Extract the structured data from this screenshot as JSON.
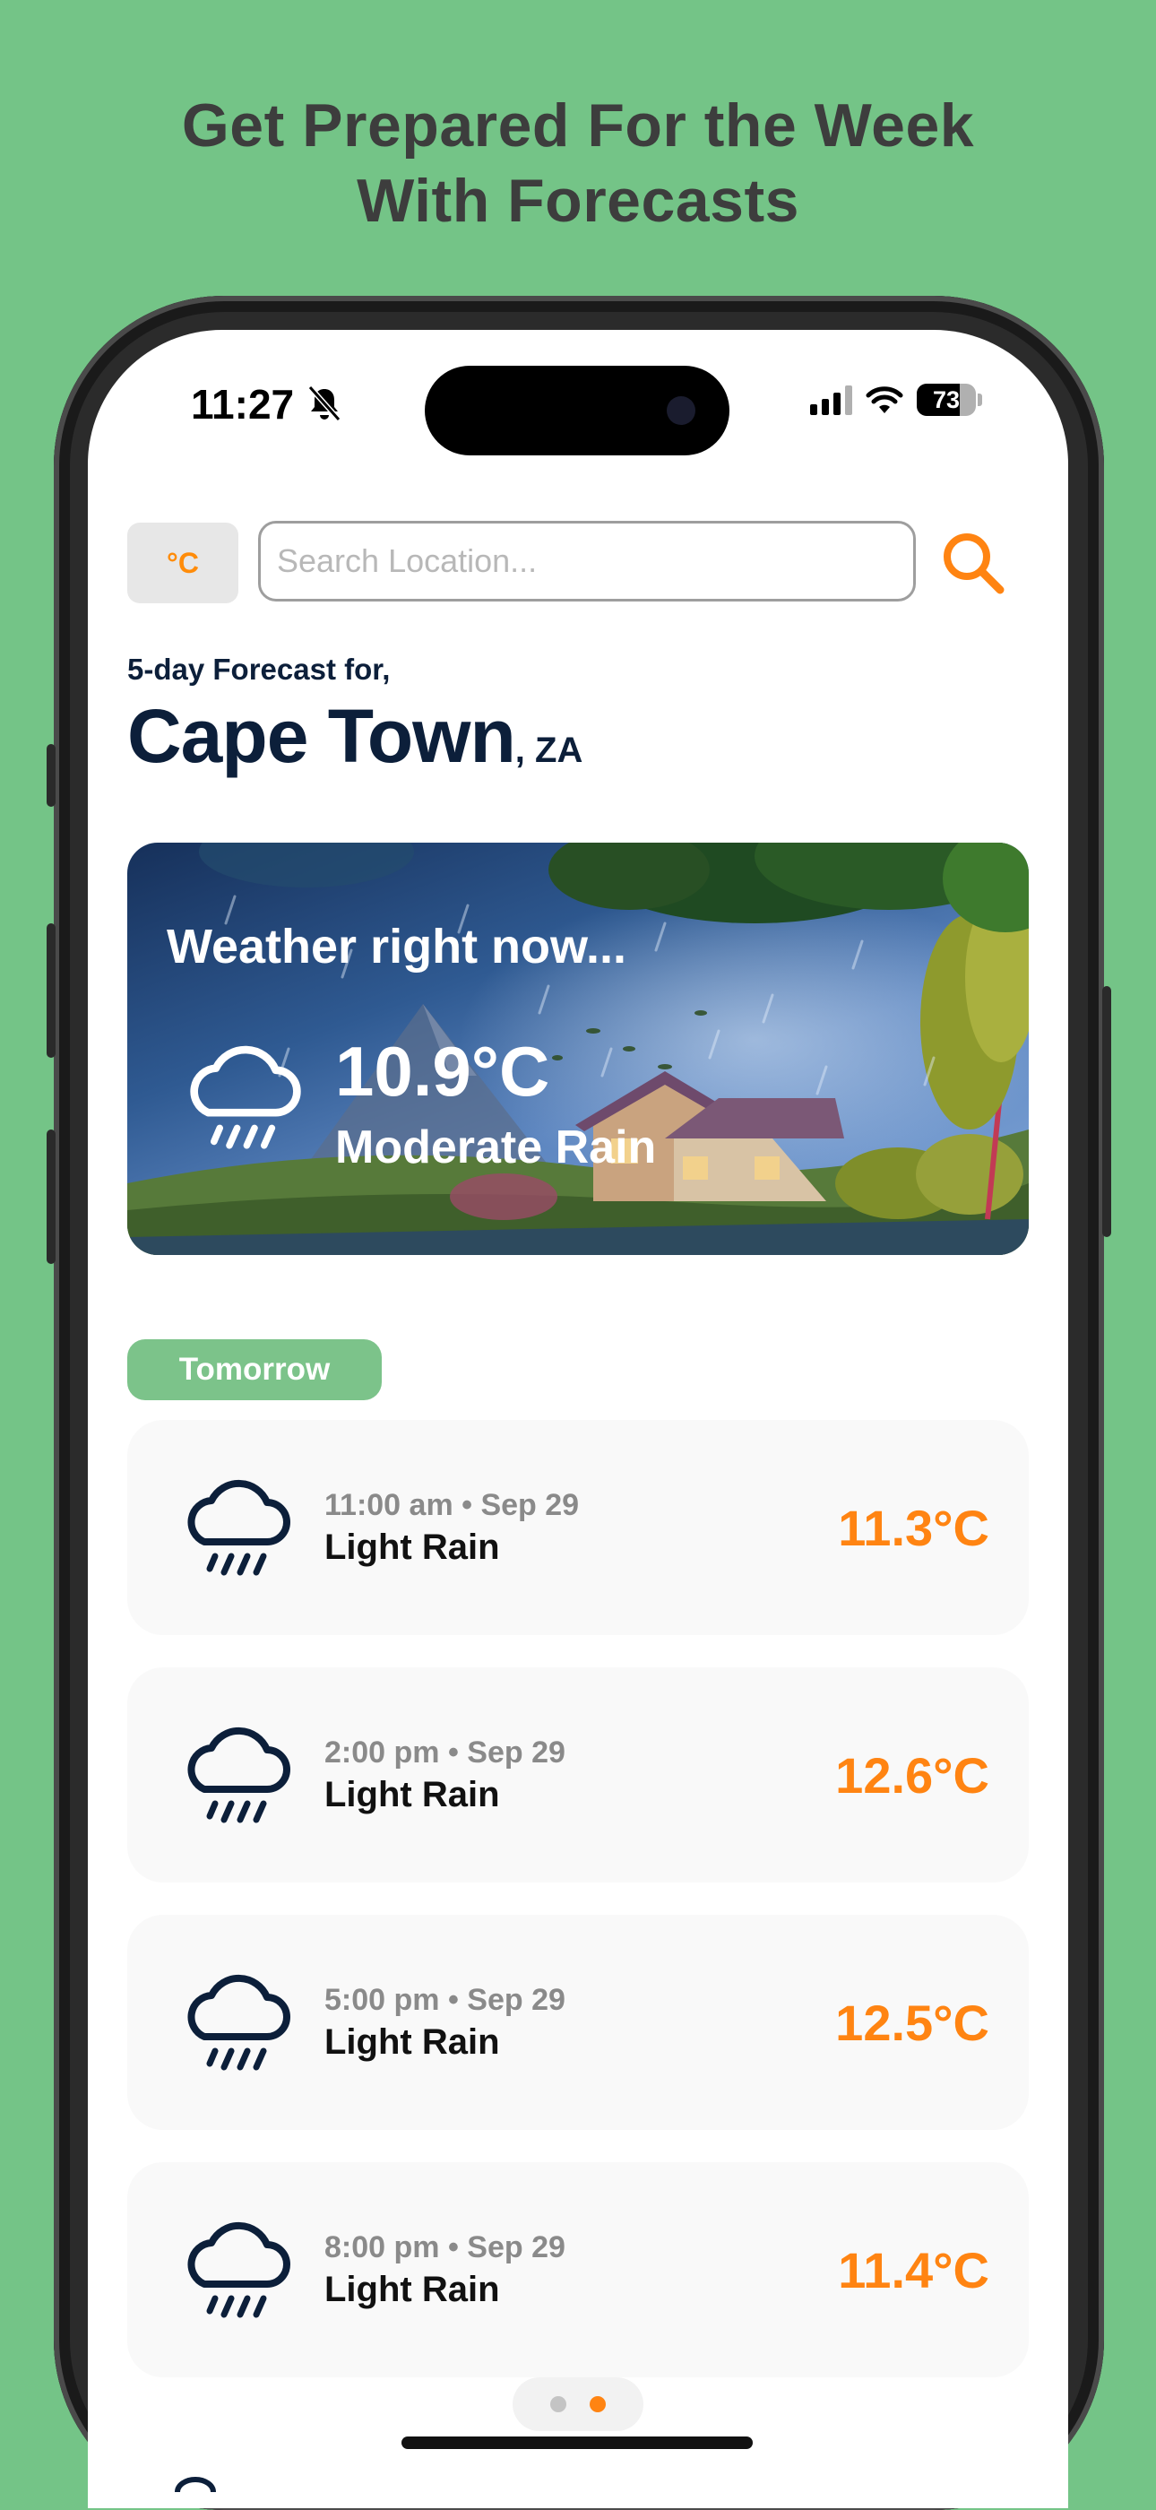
{
  "headline": {
    "line1": "Get Prepared For the Week",
    "line2": "With Forecasts"
  },
  "status_bar": {
    "time": "11:27",
    "battery": "73"
  },
  "toolbar": {
    "unit_label": "°C",
    "search_placeholder": "Search Location...",
    "search_value": ""
  },
  "location": {
    "forecast_label": "5-day Forecast for,",
    "city": "Cape Town",
    "country": ", ZA"
  },
  "current": {
    "title": "Weather right now...",
    "temp": "10.9°C",
    "condition": "Moderate Rain"
  },
  "section": {
    "label": "Tomorrow"
  },
  "forecasts": [
    {
      "time": "11:00 am • Sep 29",
      "condition": "Light Rain",
      "temp": "11.3°C"
    },
    {
      "time": "2:00 pm • Sep 29",
      "condition": "Light Rain",
      "temp": "12.6°C"
    },
    {
      "time": "5:00 pm • Sep 29",
      "condition": "Light Rain",
      "temp": "12.5°C"
    },
    {
      "time": "8:00 pm • Sep 29",
      "condition": "Light Rain",
      "temp": "11.4°C"
    }
  ],
  "pager": {
    "pages": 2,
    "active_index": 1
  },
  "colors": {
    "background": "#74c487",
    "accent": "#ff8412",
    "navy": "#0c1f3a",
    "tag": "#7cc38a",
    "card": "#f9f9f9",
    "dot_inactive": "#c4c4c4"
  },
  "icons": {
    "unit_toggle": "celsius-toggle",
    "search": "search-icon",
    "weather": "rain-cloud-icon",
    "silent": "bell-slash-icon",
    "wifi": "wifi-icon",
    "signal": "cellular-signal-icon",
    "battery": "battery-icon"
  }
}
